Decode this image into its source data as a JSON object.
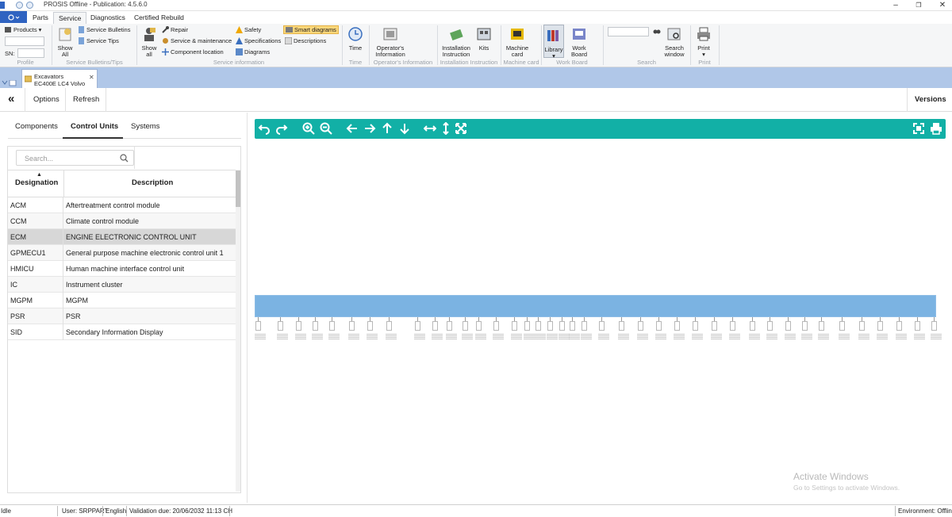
{
  "window": {
    "title": "PROSIS Offline - Publication: 4.5.6.0",
    "controls": {
      "minimize": "–",
      "maximize": "❐",
      "close": "✕"
    }
  },
  "ribbon_tabs": [
    "Parts",
    "Service",
    "Diagnostics",
    "Certified Rebuild"
  ],
  "ribbon": {
    "profile": {
      "products_label": "Products",
      "sn_label": "SN:",
      "group_label": "Profile"
    },
    "bulletins": {
      "show_all": "Show\nAll",
      "service_bulletins": "Service Bulletins",
      "service_tips": "Service Tips",
      "group_label": "Service Bulletins/Tips"
    },
    "service_info": {
      "show_all": "Show\nall",
      "repair": "Repair",
      "service_maintenance": "Service & maintenance",
      "component_location": "Component location",
      "safety": "Safety",
      "specifications": "Specifications",
      "diagrams": "Diagrams",
      "smart_diagrams": "Smart diagrams",
      "descriptions": "Descriptions",
      "group_label": "Service information"
    },
    "time": {
      "label": "Time",
      "group_label": "Time"
    },
    "operators": {
      "label": "Operator's\nInformation",
      "group_label": "Operator's Information"
    },
    "installation": {
      "instruction": "Installation\nInstruction",
      "kits": "Kits",
      "group_label": "Installation Instruction"
    },
    "machine_card": {
      "label": "Machine\ncard",
      "group_label": "Machine card"
    },
    "work_board": {
      "library": "Library",
      "work_board": "Work\nBoard",
      "group_label": "Work Board"
    },
    "search": {
      "search_window": "Search\nwindow",
      "group_label": "Search"
    },
    "print": {
      "label": "Print",
      "group_label": "Print"
    }
  },
  "doc_tab": {
    "line1": "Excavators",
    "line2": "EC400E LC4 Volvo",
    "close": "✕"
  },
  "toolbar": {
    "collapse": "«",
    "options": "Options",
    "refresh": "Refresh",
    "versions": "Versions"
  },
  "left_tabs": [
    "Components",
    "Control Units",
    "Systems"
  ],
  "search": {
    "placeholder": "Search..."
  },
  "table": {
    "headers": [
      "Designation",
      "Description"
    ],
    "rows": [
      [
        "ACM",
        "Aftertreatment control module"
      ],
      [
        "CCM",
        "Climate control module"
      ],
      [
        "ECM",
        "ENGINE ELECTRONIC CONTROL UNIT"
      ],
      [
        "GPMECU1",
        "General purpose machine electronic control unit 1"
      ],
      [
        "HMICU",
        "Human machine interface control unit"
      ],
      [
        "IC",
        "Instrument cluster"
      ],
      [
        "MGPM",
        "MGPM"
      ],
      [
        "PSR",
        "PSR"
      ],
      [
        "SID",
        "Secondary Information Display"
      ]
    ],
    "selected_row": 2
  },
  "status": {
    "state": "Idle",
    "user": "User: SRPPART",
    "language": "English",
    "validation": "Validation due: 20/06/2032 11:13 CH",
    "environment": "Environment: Offline"
  },
  "watermark": {
    "line1": "Activate Windows",
    "line2": "Go to Settings to activate Windows."
  },
  "colors": {
    "teal": "#12b0a6",
    "ribbon_blue": "#2f63c1",
    "diagram_blue": "#7bb3e2"
  }
}
